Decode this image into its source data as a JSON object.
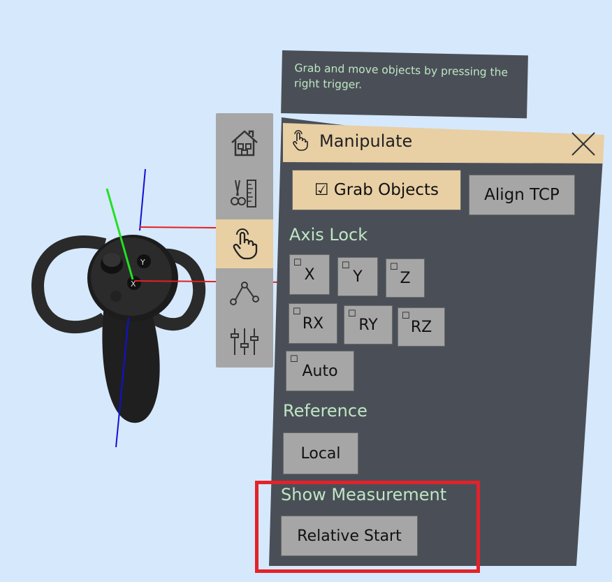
{
  "hint": {
    "text": "Grab and move objects by pressing the right trigger."
  },
  "panel": {
    "title": "Manipulate",
    "grab_objects": "☑ Grab Objects",
    "align_tcp": "Align TCP",
    "axis_lock_heading": "Axis Lock",
    "axis_buttons": [
      "X",
      "Y",
      "Z",
      "RX",
      "RY",
      "RZ",
      "Auto"
    ],
    "reference_heading": "Reference",
    "reference_value": "Local",
    "measurement_heading": "Show Measurement",
    "measurement_value": "Relative Start"
  },
  "controller": {
    "labels": [
      "Y",
      "X"
    ]
  },
  "sidebar": {
    "items": [
      "home-icon",
      "tools-icon",
      "hand-pointer-icon",
      "path-nodes-icon",
      "sliders-icon"
    ],
    "active": "hand-pointer-icon"
  },
  "colors": {
    "background": "#d6e8fb",
    "panel": "#4a4f57",
    "accent": "#e8cfa4",
    "button": "#a6a6a6",
    "section_text": "#bfe6c4",
    "highlight": "#e3222a"
  }
}
